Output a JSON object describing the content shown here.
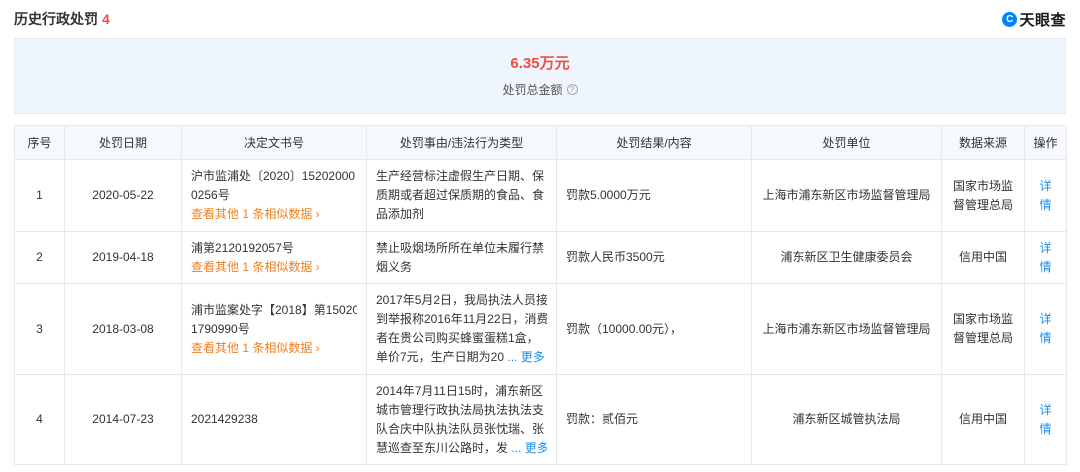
{
  "header": {
    "title": "历史行政处罚",
    "count": "4",
    "brand_symbol": "C",
    "brand_name": "天眼查"
  },
  "summary": {
    "amount": "6.35万元",
    "label": "处罚总金额",
    "info_symbol": "?"
  },
  "table": {
    "columns": [
      "序号",
      "处罚日期",
      "决定文书号",
      "处罚事由/违法行为类型",
      "处罚结果/内容",
      "处罚单位",
      "数据来源",
      "操作"
    ],
    "rows": [
      {
        "index": "1",
        "date": "2020-05-22",
        "doc_lines": [
          "沪市监浦处〔2020〕15202000",
          "0256号"
        ],
        "similar": "查看其他 1 条相似数据 ›",
        "reason_lines": [
          "生产经营标注虚假生产日期、保",
          "质期或者超过保质期的食品、食",
          "品添加剂"
        ],
        "reason_more": "",
        "result": "罚款5.0000万元",
        "unit": "上海市浦东新区市场监督管理局",
        "source_lines": [
          "国家市场监",
          "督管理总局"
        ],
        "action": "详情"
      },
      {
        "index": "2",
        "date": "2019-04-18",
        "doc_lines": [
          "浦第2120192057号"
        ],
        "similar": "查看其他 1 条相似数据 ›",
        "reason_lines": [
          "禁止吸烟场所所在单位未履行禁",
          "烟义务"
        ],
        "reason_more": "",
        "result": "罚款人民币3500元",
        "unit": "浦东新区卫生健康委员会",
        "source_lines": [
          "信用中国"
        ],
        "action": "详情"
      },
      {
        "index": "3",
        "date": "2018-03-08",
        "doc_lines": [
          "浦市监案处字【2018】第15020",
          "1790990号"
        ],
        "similar": "查看其他 1 条相似数据 ›",
        "reason_lines": [
          "2017年5月2日，我局执法人员接",
          "到举报称2016年11月22日，消费",
          "者在贵公司购买蜂蜜蛋糕1盒，"
        ],
        "reason_last": "单价7元，生产日期为20",
        "reason_more": "... 更多",
        "result": "罚款（10000.00元），",
        "unit": "上海市浦东新区市场监督管理局",
        "source_lines": [
          "国家市场监",
          "督管理总局"
        ],
        "action": "详情"
      },
      {
        "index": "4",
        "date": "2014-07-23",
        "doc_lines": [
          "2021429238"
        ],
        "similar": "",
        "reason_lines": [
          "2014年7月11日15时，浦东新区",
          "城市管理行政执法局执法执法支",
          "队合庆中队执法队员张忱瑞、张"
        ],
        "reason_last": "慧巡查至东川公路时，发",
        "reason_more": "... 更多",
        "result": "罚款：贰佰元",
        "unit": "浦东新区城管执法局",
        "source_lines": [
          "信用中国"
        ],
        "action": "详情"
      }
    ]
  }
}
